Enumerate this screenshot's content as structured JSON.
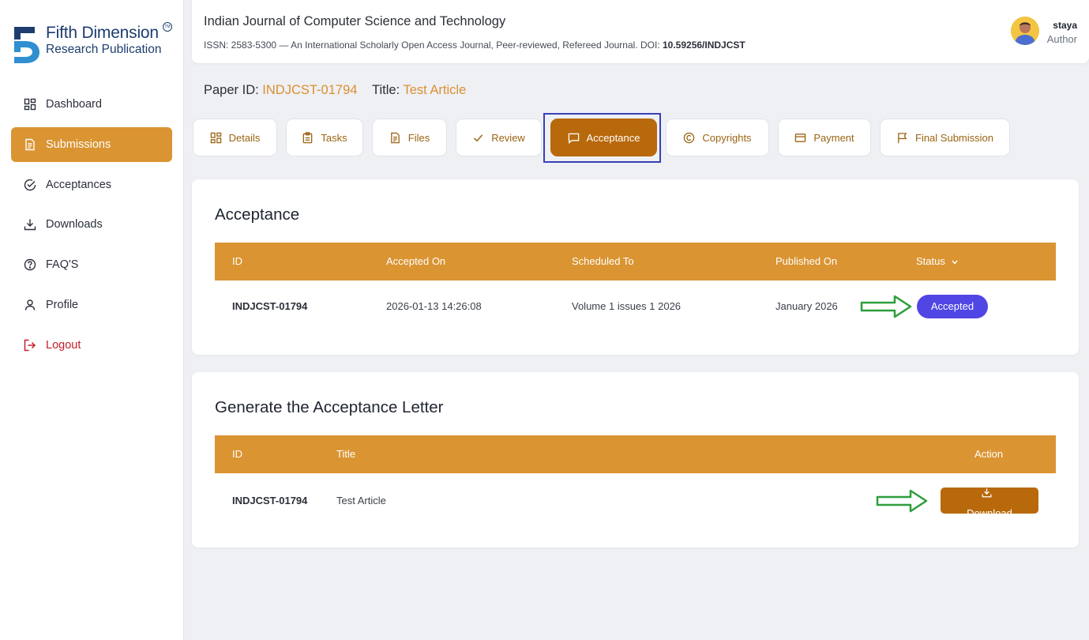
{
  "brand": {
    "line1": "Fifth Dimension",
    "line2": "Research Publication",
    "tm": "TM"
  },
  "sidebar": {
    "items": [
      {
        "label": "Dashboard",
        "icon": "grid-icon"
      },
      {
        "label": "Submissions",
        "icon": "document-icon",
        "active": true
      },
      {
        "label": "Acceptances",
        "icon": "check-circle-icon"
      },
      {
        "label": "Downloads",
        "icon": "download-icon"
      },
      {
        "label": "FAQ'S",
        "icon": "help-circle-icon"
      },
      {
        "label": "Profile",
        "icon": "user-icon"
      },
      {
        "label": "Logout",
        "icon": "logout-icon"
      }
    ]
  },
  "header": {
    "journal_title": "Indian Journal of Computer Science and Technology",
    "journal_sub": "ISSN: 2583-5300 — An International Scholarly Open Access Journal, Peer-reviewed, Refereed Journal. DOI: ",
    "doi": "10.59256/INDJCST",
    "user_name": "staya",
    "user_role": "Author"
  },
  "paper": {
    "id_label": "Paper ID:",
    "id_value": "INDJCST-01794",
    "title_label": "Title:",
    "title_value": "Test Article"
  },
  "tabs": [
    {
      "label": "Details",
      "icon": "grid-icon"
    },
    {
      "label": "Tasks",
      "icon": "clipboard-icon"
    },
    {
      "label": "Files",
      "icon": "file-icon"
    },
    {
      "label": "Review",
      "icon": "check-icon"
    },
    {
      "label": "Acceptance",
      "icon": "message-icon",
      "active": true
    },
    {
      "label": "Copyrights",
      "icon": "copyright-icon"
    },
    {
      "label": "Payment",
      "icon": "credit-card-icon"
    },
    {
      "label": "Final Submission",
      "icon": "flag-icon"
    }
  ],
  "acceptance": {
    "title": "Acceptance",
    "columns": [
      "ID",
      "Accepted On",
      "Scheduled To",
      "Published On",
      "Status"
    ],
    "row": {
      "id": "INDJCST-01794",
      "accepted_on": "2026-01-13 14:26:08",
      "scheduled_to": "Volume 1 issues 1 2026",
      "published_on": "January 2026",
      "status": "Accepted"
    }
  },
  "letter": {
    "title": "Generate the Acceptance Letter",
    "columns": [
      "ID",
      "Title",
      "Action"
    ],
    "row": {
      "id": "INDJCST-01794",
      "title": "Test Article",
      "action": "Download"
    }
  },
  "colors": {
    "accent": "#da9432",
    "tab_active": "#b8690b",
    "status_badge": "#5046e4",
    "logout": "#c21f2b",
    "annotation_arrow": "#2e9e3c",
    "annotation_box": "#3b3fb5"
  }
}
